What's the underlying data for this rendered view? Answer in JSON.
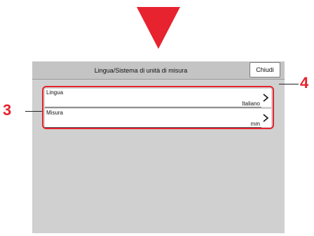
{
  "window": {
    "title": "Lingua/Sistema di unità di misura",
    "close_label": "Chiudi"
  },
  "settings": {
    "items": [
      {
        "label": "Lingua",
        "value": "Italiano",
        "icon": "chevron-right-icon"
      },
      {
        "label": "Misura",
        "value": "mm",
        "icon": "chevron-right-icon"
      }
    ]
  },
  "callouts": {
    "list": "3",
    "close": "4"
  },
  "colors": {
    "accent": "#e6232e",
    "panel_bg": "#d0d0d0",
    "titlebar_bg": "#c4c4c4",
    "row_bg": "#ffffff"
  }
}
